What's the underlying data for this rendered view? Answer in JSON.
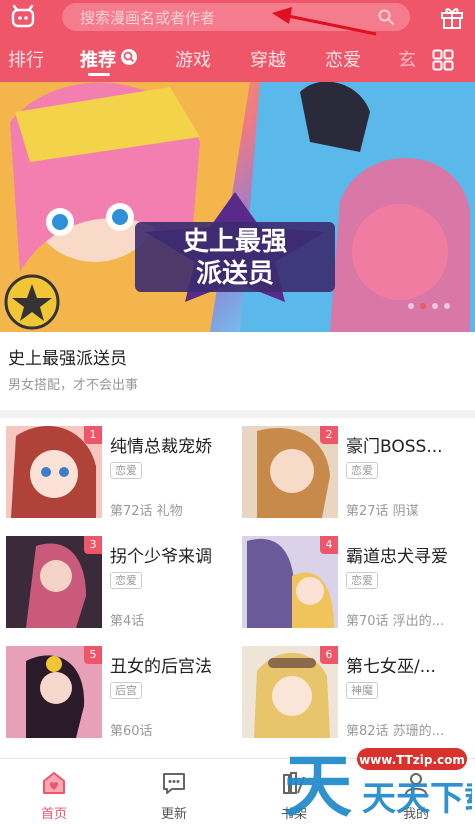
{
  "search": {
    "placeholder": "搜索漫画名或者作者"
  },
  "tabs": [
    {
      "label": "排行"
    },
    {
      "label": "推荐"
    },
    {
      "label": "游戏"
    },
    {
      "label": "穿越"
    },
    {
      "label": "恋爱"
    },
    {
      "label": "玄"
    }
  ],
  "banner": {
    "art_title_line1": "史上最强",
    "art_title_line2": "派送员",
    "title": "史上最强派送员",
    "desc": "男女搭配，才不会出事"
  },
  "comics": [
    {
      "rank": "1",
      "title": "纯情总裁宠娇",
      "tag": "恋爱",
      "episode": "第72话 礼物"
    },
    {
      "rank": "2",
      "title": "豪门BOSS...",
      "tag": "恋爱",
      "episode": "第27话 阴谋"
    },
    {
      "rank": "3",
      "title": "拐个少爷来调",
      "tag": "恋爱",
      "episode": "第4话"
    },
    {
      "rank": "4",
      "title": "霸道忠犬寻爱",
      "tag": "恋爱",
      "episode": "第70话 浮出的..."
    },
    {
      "rank": "5",
      "title": "丑女的后宫法",
      "tag": "后宫",
      "episode": "第60话"
    },
    {
      "rank": "6",
      "title": "第七女巫/...",
      "tag": "神魔",
      "episode": "第82话 苏珊的..."
    }
  ],
  "nav": [
    {
      "label": "首页"
    },
    {
      "label": "更新"
    },
    {
      "label": "书架"
    },
    {
      "label": "我的"
    }
  ],
  "watermark": {
    "url": "www.TTzip.com",
    "text": "天天下载"
  },
  "colors": {
    "brand": "#f0566a",
    "watermark": "#1e88c9"
  }
}
